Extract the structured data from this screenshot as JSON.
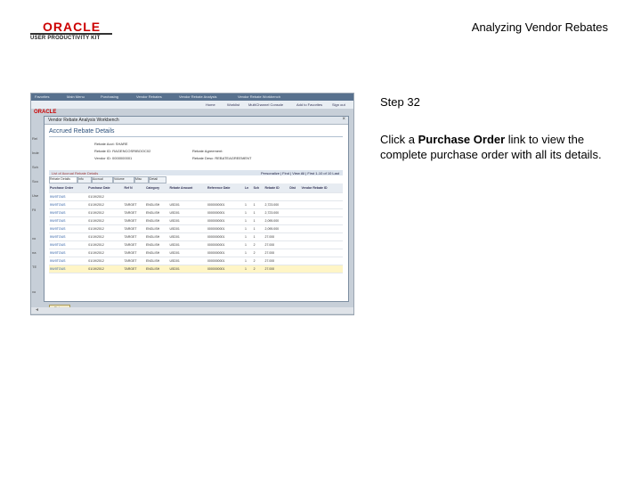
{
  "logo": {
    "brand": "ORACLE",
    "product": "USER PRODUCTIVITY KIT"
  },
  "title": "Analyzing Vendor Rebates",
  "step": "Step 32",
  "instruction": {
    "prefix": "Click a ",
    "emphasis": "Purchase Order",
    "suffix": " link to view the complete purchase order with all its details."
  },
  "screenshot": {
    "topbar": [
      "Favorites",
      "Main Menu",
      "Purchasing",
      "Vendor Rebates",
      "Vendor Rebate Analysis",
      "Vendor Rebate Workbench"
    ],
    "navbar": [
      "Home",
      "Worklist",
      "MultiChannel Console",
      "Add to Favorites",
      "Sign out"
    ],
    "mini_logo": "ORACLE",
    "left_labels": [
      "Rel",
      "Inde",
      "Sch",
      "Sco",
      "Use",
      "Fil",
      "vo",
      "na",
      "TE",
      "vo"
    ],
    "dialog_title": "Vendor Rebate Analysis Workbench",
    "dialog_close": "×",
    "heading": "Accrued Rebate Details",
    "fields": [
      {
        "label": "Rebate Acct: ",
        "value": "SHARE"
      },
      {
        "label": "Rebate ID: ",
        "value": "RAGENCOSRIBOOC02"
      },
      {
        "label": "Vendor ID: ",
        "value": "0000000001"
      },
      {
        "label": "Rebate Agreement: ",
        "value": ""
      },
      {
        "label": "Rebate Desc: ",
        "value": "REBATEAGREEMENT"
      }
    ],
    "grid_title": "List of Accrual Rebate Details",
    "grid_nav": "Personalize | Find | View All | First 1-10 of 10 Last",
    "tabs": [
      "Rebate Details",
      "Info",
      "Accrual",
      "Volume",
      "Misc",
      "Detail"
    ],
    "columns": [
      "Purchase Order",
      "Purchase Date",
      "Ref N",
      "Category",
      "Rebate Amount",
      "Reference Date",
      "Ln",
      "Sch",
      "Rebate ID",
      "Dist",
      "Vendor Rebate ID"
    ],
    "rows": [
      [
        "INV0TOUS",
        "01/19/2012",
        "",
        "",
        "",
        "",
        "",
        "",
        "",
        "",
        ""
      ],
      [
        "INV0TOUS",
        "01/19/2012",
        "TARGET",
        "ENGLISH",
        "USD01",
        "0000000001",
        "1",
        "1",
        "2,723.000",
        "",
        ""
      ],
      [
        "INV0TOUS",
        "01/19/2012",
        "TARGET",
        "ENGLISH",
        "USD01",
        "0000000001",
        "1",
        "1",
        "2,723.000",
        "",
        ""
      ],
      [
        "INV0TOUS",
        "01/19/2012",
        "TARGET",
        "ENGLISH",
        "USD01",
        "0000000001",
        "1",
        "1",
        "2,095.000",
        "",
        ""
      ],
      [
        "INV0TOUS",
        "01/19/2012",
        "TARGET",
        "ENGLISH",
        "USD01",
        "0000000001",
        "1",
        "1",
        "2,095.000",
        "",
        ""
      ],
      [
        "INV0TOUS",
        "01/19/2012",
        "TARGET",
        "ENGLISH",
        "USD01",
        "0000000001",
        "1",
        "1",
        "27.000",
        "",
        ""
      ],
      [
        "INV0TOUS",
        "01/19/2012",
        "TARGET",
        "ENGLISH",
        "USD01",
        "0000000001",
        "1",
        "2",
        "27.000",
        "",
        ""
      ],
      [
        "INV0TOUS",
        "01/19/2012",
        "TARGET",
        "ENGLISH",
        "USD01",
        "0000000001",
        "1",
        "2",
        "27.000",
        "",
        ""
      ],
      [
        "INV0TOUS",
        "01/19/2012",
        "TARGET",
        "ENGLISH",
        "USD01",
        "0000000001",
        "1",
        "2",
        "27.000",
        "",
        ""
      ],
      [
        "INV0TOUS",
        "01/19/2012",
        "TARGET",
        "ENGLISH",
        "USD01",
        "0000000001",
        "1",
        "2",
        "27.000",
        "",
        ""
      ]
    ],
    "selected_row": 9,
    "return_button": "Return",
    "scroll_hint": "◄"
  },
  "colors": {
    "logo_red": "#cc0000",
    "highlight": "#fff5c6",
    "heading_blue": "#2b4f7a"
  }
}
